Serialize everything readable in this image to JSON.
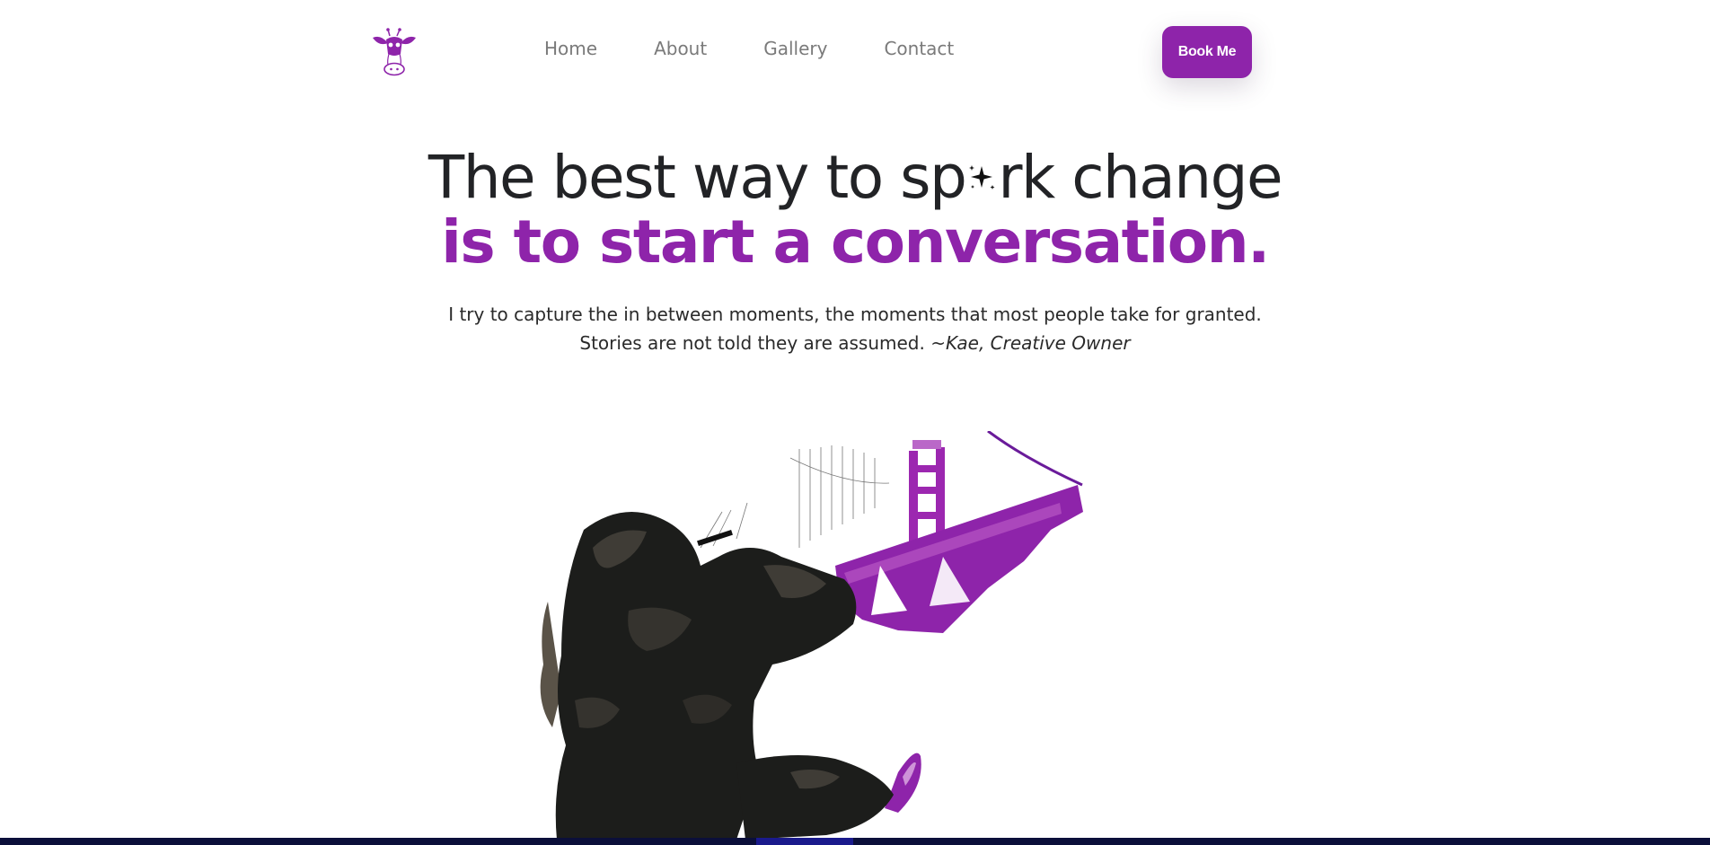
{
  "header": {
    "logo_icon": "giraffe-logo-icon",
    "nav": [
      "Home",
      "About",
      "Gallery",
      "Contact"
    ],
    "cta_label": "Book Me"
  },
  "hero": {
    "headline_part1": "The best way to sp",
    "headline_part2": "rk change",
    "spark_icon": "sparkle-icon",
    "headline_line2": "is to start a conversation.",
    "quote_line1": "I try to capture the in between moments, the moments that most people take for granted.",
    "quote_line2": "Stories are not told they are assumed.",
    "quote_author": "~Kae, Creative Owner",
    "illustration": "photographer-golden-gate-bridge-illustration"
  },
  "colors": {
    "brand": "#8e24aa",
    "text_dark": "#222326",
    "nav_text": "#7a7a7a",
    "bottom_bar": "#0b0f3a"
  }
}
